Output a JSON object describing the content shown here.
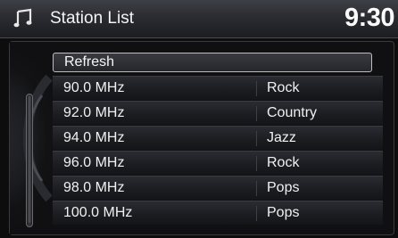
{
  "header": {
    "title": "Station List",
    "clock": "9:30",
    "icon": "music-note-icon"
  },
  "refresh": {
    "label": "Refresh"
  },
  "stations": [
    {
      "freq": "90.0 MHz",
      "genre": "Rock"
    },
    {
      "freq": "92.0 MHz",
      "genre": "Country"
    },
    {
      "freq": "94.0 MHz",
      "genre": "Jazz"
    },
    {
      "freq": "96.0 MHz",
      "genre": "Rock"
    },
    {
      "freq": "98.0 MHz",
      "genre": "Pops"
    },
    {
      "freq": "100.0 MHz",
      "genre": "Pops"
    }
  ],
  "colors": {
    "header_bg": "#2b2c31",
    "panel_bg": "#101012",
    "text": "#f0f0f0",
    "highlight_border": "#bdbdbd"
  }
}
